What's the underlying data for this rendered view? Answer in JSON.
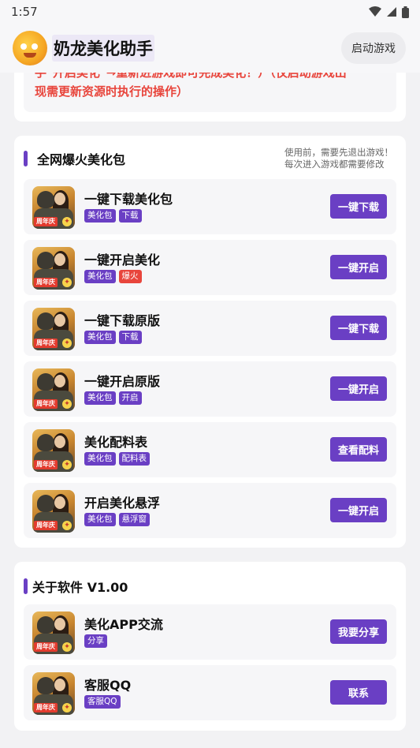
{
  "status": {
    "time": "1:57"
  },
  "header": {
    "title": "奶龙美化助手",
    "launch_button": "启动游戏"
  },
  "notice": {
    "line1": "手\"开启美化\"→重新进游戏即可完成美化！）（仅启动游戏出",
    "line2": "现需更新资源时执行的操作）"
  },
  "main_section": {
    "title": "全网爆火美化包",
    "note_line1": "使用前，需要先退出游戏！",
    "note_line2": "每次进入游戏都需要修改",
    "items": [
      {
        "title": "一键下载美化包",
        "tags": [
          "美化包",
          "下载"
        ],
        "button": "一键下载"
      },
      {
        "title": "一键开启美化",
        "tags": [
          "美化包",
          "爆火"
        ],
        "button": "一键开启"
      },
      {
        "title": "一键下载原版",
        "tags": [
          "美化包",
          "下载"
        ],
        "button": "一键下载"
      },
      {
        "title": "一键开启原版",
        "tags": [
          "美化包",
          "开启"
        ],
        "button": "一键开启"
      },
      {
        "title": "美化配料表",
        "tags": [
          "美化包",
          "配料表"
        ],
        "button": "查看配料"
      },
      {
        "title": "开启美化悬浮",
        "tags": [
          "美化包",
          "悬浮窗"
        ],
        "button": "一键开启"
      }
    ]
  },
  "about_section": {
    "title": "关于软件 V1.00",
    "items": [
      {
        "title": "美化APP交流",
        "tags": [
          "分享"
        ],
        "button": "我要分享"
      },
      {
        "title": "客服QQ",
        "tags": [
          "客服QQ"
        ],
        "button": "联系"
      }
    ]
  },
  "game_icon_badge": "周年庆",
  "colors": {
    "accent": "#6a3fc4",
    "hot": "#e8453c",
    "notice": "#e8453c"
  }
}
